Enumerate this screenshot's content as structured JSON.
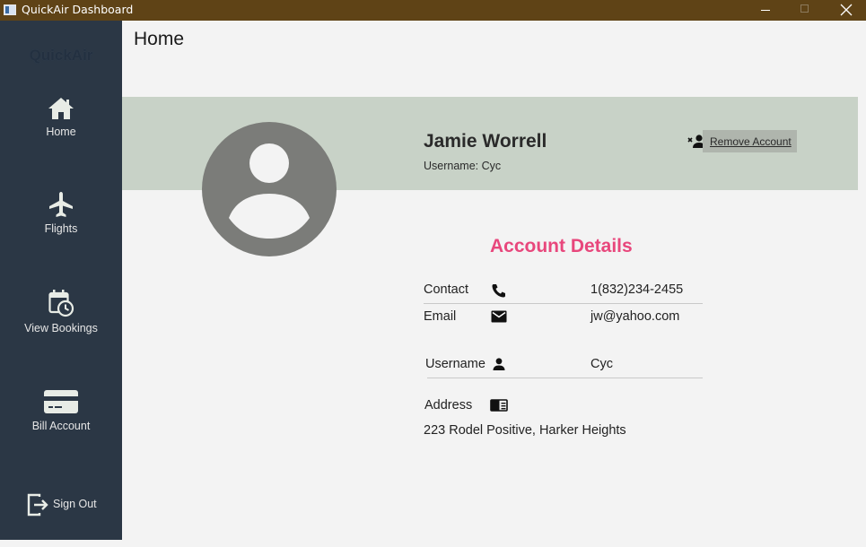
{
  "window": {
    "title": "QuickAir Dashboard"
  },
  "sidebar": {
    "brand": "QuickAir",
    "items": [
      {
        "label": "Home",
        "icon": "home-icon"
      },
      {
        "label": "Flights",
        "icon": "airplane-icon"
      },
      {
        "label": "View Bookings",
        "icon": "calendar-clock-icon"
      },
      {
        "label": "Bill Account",
        "icon": "credit-card-icon"
      }
    ],
    "sign_out": {
      "label": "Sign Out",
      "icon": "logout-icon"
    }
  },
  "main": {
    "page_title": "Home",
    "profile": {
      "name": "Jamie Worrell",
      "username_line": "Username: Cyc",
      "remove_label": "Remove Account"
    },
    "details": {
      "heading": "Account Details",
      "contact_label": "Contact",
      "contact_value": "1(832)234-2455",
      "email_label": "Email",
      "email_value": "jw@yahoo.com",
      "username_label": "Username",
      "username_value": "Cyc",
      "address_label": "Address",
      "address_value": "223 Rodel Positive, Harker Heights"
    }
  },
  "colors": {
    "titlebar": "#5f4316",
    "sidebar": "#2b3745",
    "banner": "#c8d2c7",
    "heading_accent": "#e8477c",
    "avatar": "#7b7c79"
  }
}
